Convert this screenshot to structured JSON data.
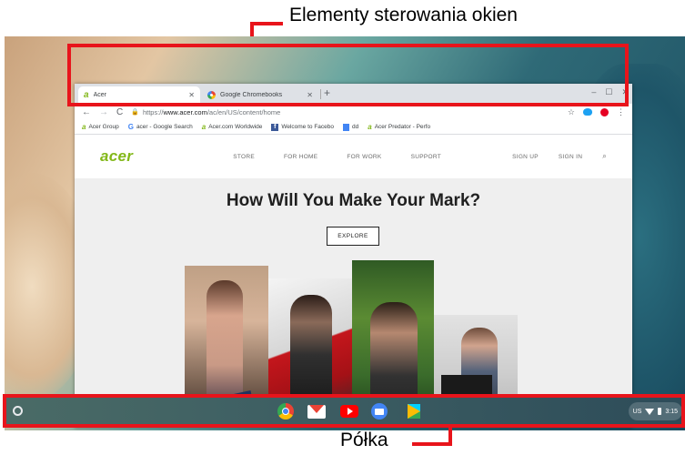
{
  "callouts": {
    "window_controls": "Elementy sterowania okien",
    "shelf": "Półka",
    "highlight_color": "#e8141b"
  },
  "browser": {
    "tabs": [
      {
        "label": "Acer",
        "icon": "acer-logo-icon",
        "active": true
      },
      {
        "label": "Google Chromebooks",
        "icon": "google-icon",
        "active": false
      }
    ],
    "new_tab": "+",
    "window_controls": {
      "minimize": "–",
      "maximize": "☐",
      "close": "✕"
    },
    "address": {
      "secure_prefix": "https://",
      "host": "www.acer.com",
      "path": "/ac/en/US/content/home"
    },
    "bookmarks": [
      {
        "label": "Acer Group",
        "icon": "acer-logo-icon"
      },
      {
        "label": "acer - Google Search",
        "icon": "google-icon"
      },
      {
        "label": "Acer.com Worldwide",
        "icon": "acer-logo-icon"
      },
      {
        "label": "Welcome to Facebo",
        "icon": "facebook-icon"
      },
      {
        "label": "dd",
        "icon": "docs-icon"
      },
      {
        "label": "Acer Predator - Perfo",
        "icon": "acer-logo-icon"
      }
    ],
    "extensions": [
      "star-icon",
      "twitter-icon",
      "pinterest-icon",
      "kebab-menu-icon"
    ]
  },
  "site": {
    "logo": "acer",
    "logo_color": "#83b81a",
    "nav": [
      "STORE",
      "FOR HOME",
      "FOR WORK",
      "SUPPORT"
    ],
    "nav_right": [
      "SIGN UP",
      "SIGN IN"
    ],
    "hero_title": "How Will You Make Your Mark?",
    "cta": "EXPLORE"
  },
  "shelf": {
    "apps": [
      "chrome-icon",
      "gmail-icon",
      "youtube-icon",
      "files-icon",
      "play-store-icon"
    ],
    "status": {
      "locale": "US",
      "time": "3:15"
    }
  }
}
